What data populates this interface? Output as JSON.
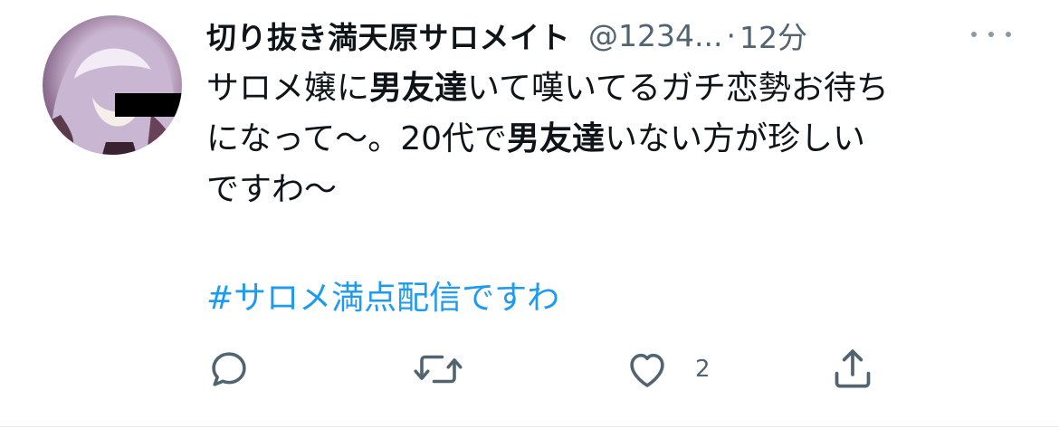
{
  "tweet": {
    "display_name": "切り抜き満天原サロメイト",
    "handle": "@1234...",
    "separator": "·",
    "time": "12分",
    "lines": [
      {
        "a": "サロメ嬢に",
        "b": "男友達",
        "c": "いて嘆いてるガチ恋勢お待ち"
      },
      {
        "a": "になって〜。20代で",
        "b": "男友達",
        "c": "いない方が珍しい"
      },
      {
        "a": "ですわ〜",
        "b": "",
        "c": ""
      }
    ],
    "hashtag": "#サロメ満点配信ですわ",
    "likes_count": "2"
  },
  "icons": {
    "more": "more-dots-icon",
    "reply": "reply-icon",
    "retweet": "retweet-icon",
    "like": "heart-icon",
    "share": "share-icon"
  },
  "colors": {
    "text": "#0f1419",
    "muted": "#536471",
    "link": "#1d9bf0",
    "divider": "#e7e9ea"
  }
}
